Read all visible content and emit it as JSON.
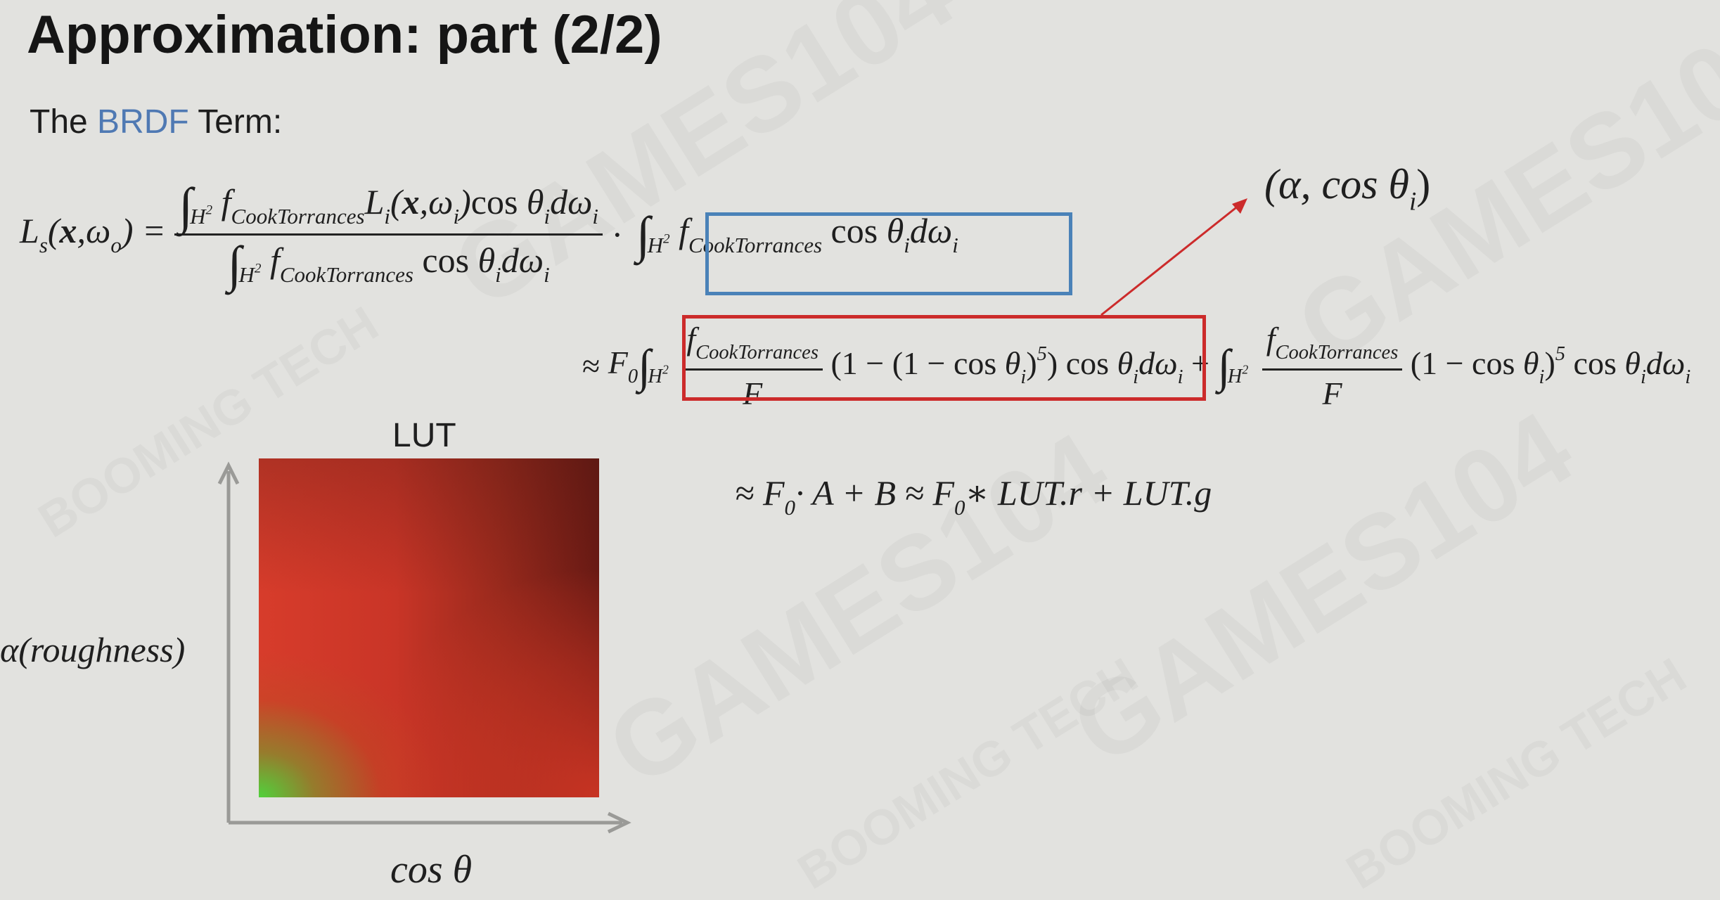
{
  "slide": {
    "title": "Approximation: part (2/2)",
    "subtitle": {
      "prefix": "The ",
      "highlight": "BRDF",
      "suffix": " Term:"
    },
    "watermark": "GAMES104",
    "watermark_secondary": "BOOMING TECH"
  },
  "equations": {
    "lhs": "L",
    "lhs_sub": "s",
    "lhs_args_x": "x",
    "lhs_args_w": "ω",
    "lhs_args_w_sub": "o",
    "f_symbol": "f",
    "f_sub": "CookTorrances",
    "domain": "H",
    "domain_sup": "2",
    "L_i": "L",
    "L_i_sub": "i",
    "omega_i_sub": "i",
    "theta": "θ",
    "F0": "F",
    "F0_sub": "0",
    "F": "F",
    "power": "5",
    "final_approx_1": "≈ F",
    "final_approx_sub": "0",
    "final_approx_2": "· A + B  ≈ F",
    "final_approx_3": "∗ LUT.r  +  LUT.g"
  },
  "annotation": {
    "label": "(α, cos θ",
    "label_sub": "i",
    "label_close": ")",
    "arrow_color": "#cc2b2b"
  },
  "lut": {
    "label": "LUT",
    "y_axis_label": "α(roughness)",
    "x_axis_label": "cos θ"
  },
  "colors": {
    "background": "#e2e2df",
    "brdf_highlight": "#4f79b3",
    "blue_box": "#4a82b8",
    "red_box": "#cc2b2b"
  }
}
